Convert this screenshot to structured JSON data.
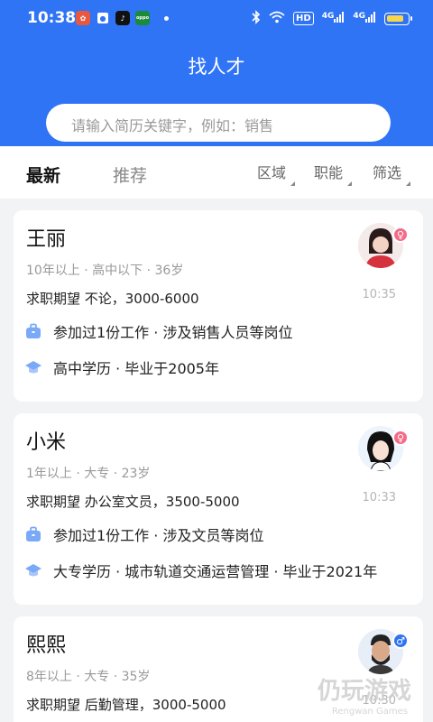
{
  "status_bar": {
    "time": "10:38",
    "app_icons": [
      "app-icon-1",
      "app-icon-2",
      "app-icon-3",
      "oppo-icon"
    ],
    "hd": "HD",
    "net1": "4G",
    "net2": "4G"
  },
  "header": {
    "title": "找人才",
    "search_placeholder": "请输入简历关键字，例如：销售"
  },
  "tabs": {
    "latest": "最新",
    "recommended": "推荐"
  },
  "filters": {
    "region": "区域",
    "function": "职能",
    "filter": "筛选"
  },
  "cards": [
    {
      "name": "王丽",
      "meta": "10年以上 · 高中以下 · 36岁",
      "expect": "求职期望 不论，3000-6000",
      "work": "参加过1份工作 · 涉及销售人员等岗位",
      "edu": "高中学历 · 毕业于2005年",
      "time": "10:35",
      "gender_symbol": "♀"
    },
    {
      "name": "小米",
      "meta": "1年以上 · 大专 · 23岁",
      "expect": "求职期望 办公室文员，3500-5000",
      "work": "参加过1份工作 · 涉及文员等岗位",
      "edu": "大专学历 · 城市轨道交通运营管理 · 毕业于2021年",
      "time": "10:33",
      "gender_symbol": "♀"
    },
    {
      "name": "熙熙",
      "meta": "8年以上 · 大专 · 35岁",
      "expect": "求职期望 后勤管理，3000-5000",
      "time": "10:30",
      "gender_symbol": "♂"
    }
  ],
  "watermark": {
    "text": "仍玩游戏",
    "sub": "Rengwan Games"
  },
  "colors": {
    "primary": "#2f74f5",
    "female": "#f26d87",
    "icon_blue": "#7aa9f7"
  }
}
